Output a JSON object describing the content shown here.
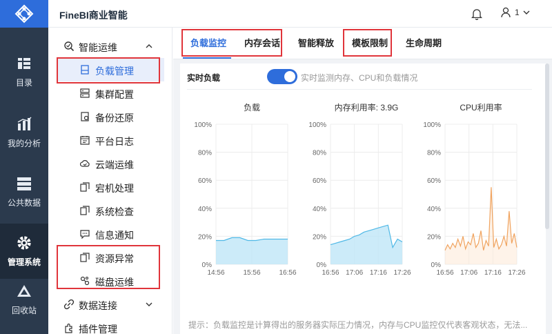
{
  "app": {
    "title": "FineBI商业智能"
  },
  "topbar": {
    "user_label": "1"
  },
  "leftnav": {
    "items": [
      {
        "label": "目录",
        "icon": "catalog-icon"
      },
      {
        "label": "我的分析",
        "icon": "analysis-icon"
      },
      {
        "label": "公共数据",
        "icon": "database-icon"
      },
      {
        "label": "管理系统",
        "icon": "gear-icon"
      },
      {
        "label": "回收站",
        "icon": "recycle-icon"
      }
    ],
    "active_index": 3
  },
  "sidebar": {
    "groups": [
      {
        "label": "智能运维",
        "icon": "ops-icon",
        "expanded": true
      },
      {
        "label": "数据连接",
        "icon": "link-icon",
        "expanded": false
      },
      {
        "label": "插件管理",
        "icon": "plugin-icon"
      }
    ],
    "items": [
      {
        "label": "负载管理",
        "icon": "load-icon"
      },
      {
        "label": "集群配置",
        "icon": "cluster-icon"
      },
      {
        "label": "备份还原",
        "icon": "backup-icon"
      },
      {
        "label": "平台日志",
        "icon": "log-icon"
      },
      {
        "label": "云端运维",
        "icon": "cloud-icon"
      },
      {
        "label": "宕机处理",
        "icon": "crash-icon"
      },
      {
        "label": "系统检查",
        "icon": "check-icon"
      },
      {
        "label": "信息通知",
        "icon": "message-icon"
      },
      {
        "label": "资源异常",
        "icon": "resource-icon"
      },
      {
        "label": "磁盘运维",
        "icon": "disk-icon"
      }
    ],
    "selected_index": 0
  },
  "tabs": [
    {
      "label": "负载监控"
    },
    {
      "label": "内存会话"
    },
    {
      "label": "智能释放"
    },
    {
      "label": "模板限制"
    },
    {
      "label": "生命周期"
    }
  ],
  "active_tab": 0,
  "realtime": {
    "label": "实时负载",
    "toggle_on": true,
    "description": "实时监测内存、CPU和负载情况"
  },
  "hint": "提示：负载监控是计算得出的服务器实际压力情况，内存与CPU监控仅代表客观状态，无法...",
  "colors": {
    "accent": "#2e6ddb",
    "highlight_box": "#e0343a",
    "load_fill": "#bfe6f7",
    "load_line": "#4fb8e6",
    "cpu_line": "#f0a35e"
  },
  "chart_data": [
    {
      "type": "area",
      "title": "负载",
      "x_ticks": [
        "14:56",
        "15:56",
        "16:56"
      ],
      "y_ticks": [
        "100%",
        "80%",
        "60%",
        "40%",
        "20%",
        "0%"
      ],
      "ylim": [
        0,
        100
      ],
      "series": [
        {
          "values": [
            17,
            17,
            19,
            19,
            17,
            17,
            18,
            18,
            18,
            18
          ]
        }
      ]
    },
    {
      "type": "area",
      "title": "内存利用率: 3.9G",
      "x_ticks": [
        "16:56",
        "17:06",
        "17:16",
        "17:26"
      ],
      "y_ticks": [
        "100%",
        "80%",
        "60%",
        "40%",
        "20%",
        "0%"
      ],
      "ylim": [
        0,
        100
      ],
      "series": [
        {
          "values": [
            14,
            15,
            16,
            17,
            18,
            20,
            21,
            23,
            24,
            25,
            26,
            27,
            28,
            12,
            18,
            16
          ]
        }
      ]
    },
    {
      "type": "line",
      "title": "CPU利用率",
      "x_ticks": [
        "16:56",
        "17:06",
        "17:16",
        "17:26"
      ],
      "y_ticks": [
        "100%",
        "80%",
        "60%",
        "40%",
        "20%",
        "0%"
      ],
      "ylim": [
        0,
        100
      ],
      "series": [
        {
          "values": [
            10,
            14,
            11,
            15,
            12,
            18,
            13,
            20,
            11,
            16,
            14,
            22,
            12,
            15,
            24,
            10,
            17,
            13,
            55,
            12,
            18,
            11,
            14,
            20,
            13,
            38,
            15,
            22,
            12
          ]
        }
      ]
    }
  ]
}
